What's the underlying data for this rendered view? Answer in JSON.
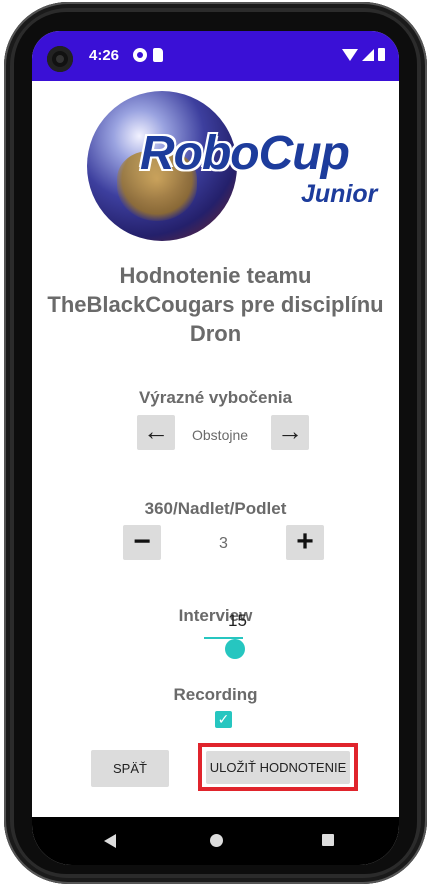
{
  "status_bar": {
    "time": "4:26",
    "icons": [
      "g-notification-icon",
      "sd-card-icon",
      "wifi-icon",
      "signal-icon",
      "battery-icon"
    ]
  },
  "logo": {
    "title": "RoboCup",
    "subtitle": "Junior"
  },
  "page": {
    "title": "Hodnotenie teamu TheBlackCougars pre disciplínu Dron"
  },
  "criteria": {
    "deviations": {
      "label": "Výrazné vybočenia",
      "value": "Obstojne",
      "prev_symbol": "←",
      "next_symbol": "→"
    },
    "rotation": {
      "label": "360/Nadlet/Podlet",
      "value": "3",
      "minus_symbol": "−",
      "plus_symbol": "+"
    },
    "interview": {
      "label": "Interview",
      "value": "15"
    },
    "recording": {
      "label": "Recording",
      "checked": true,
      "check_symbol": "✓"
    }
  },
  "actions": {
    "back_label": "SPÄŤ",
    "save_label": "ULOŽIŤ HODNOTENIE"
  },
  "colors": {
    "status_bar": "#3a10d6",
    "accent": "#26c6c0",
    "highlight": "#e0242c",
    "logo_text": "#1d3c9c"
  }
}
